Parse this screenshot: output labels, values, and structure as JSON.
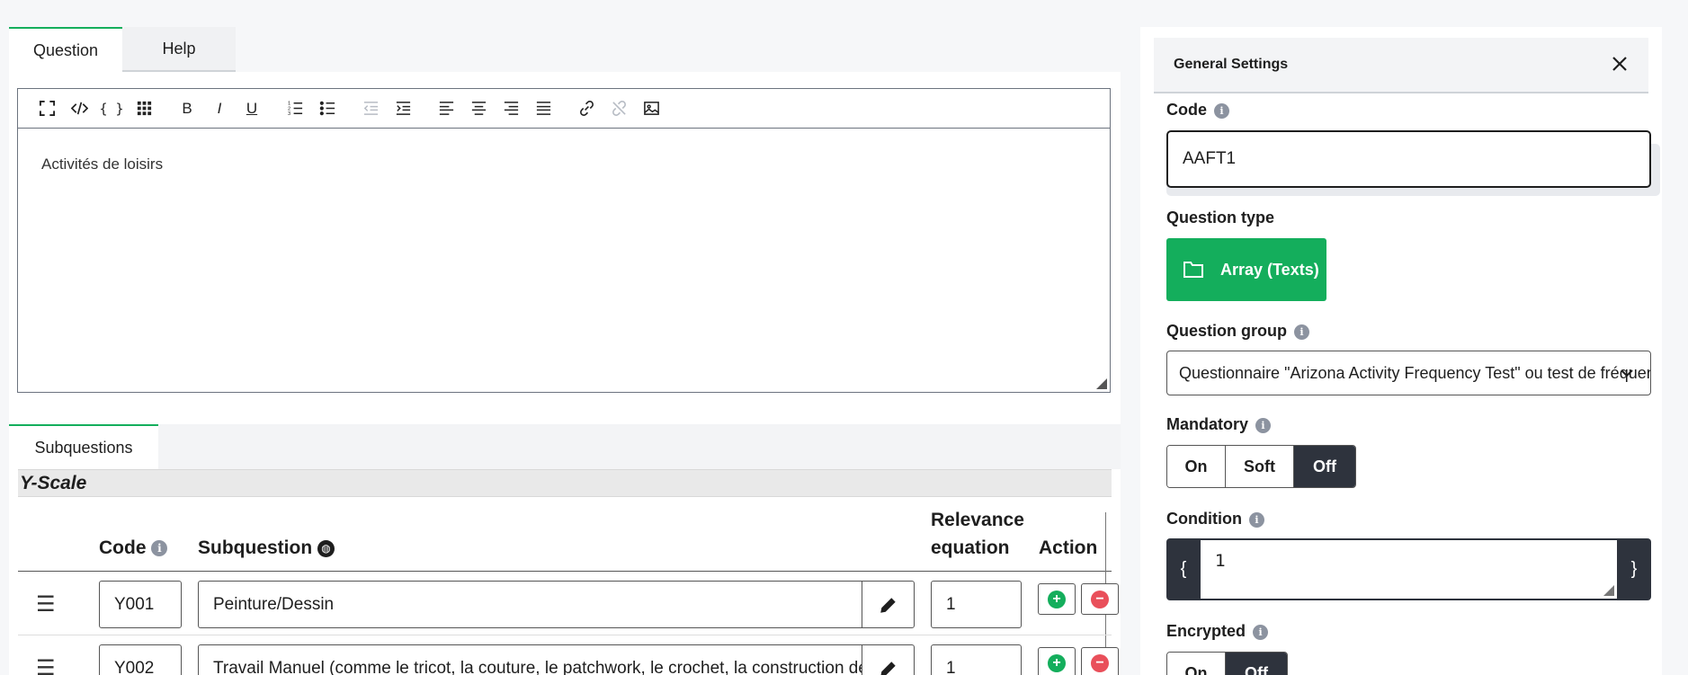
{
  "tabs": {
    "question": "Question",
    "help": "Help"
  },
  "toolbar": {
    "buttons": [
      "fullscreen-icon",
      "source-code-icon",
      "expression-icon",
      "grid-icon",
      "bold-icon",
      "italic-icon",
      "underline-icon",
      "ordered-list-icon",
      "bullet-list-icon",
      "outdent-icon",
      "indent-icon",
      "align-left-icon",
      "align-center-icon",
      "align-right-icon",
      "justify-icon",
      "link-icon",
      "unlink-icon",
      "image-icon"
    ],
    "bold": "B",
    "italic": "I",
    "underline": "U"
  },
  "editor": {
    "content": "Activités de loisirs"
  },
  "subquestions": {
    "tab_label": "Subquestions",
    "scale_title": "Y-Scale",
    "columns": {
      "code": "Code",
      "subquestion": "Subquestion",
      "relevance_line1": "Relevance",
      "relevance_line2": "equation",
      "action": "Action"
    },
    "rows": [
      {
        "code": "Y001",
        "text": "Peinture/Dessin",
        "relevance": "1"
      },
      {
        "code": "Y002",
        "text": "Travail Manuel (comme le tricot, la couture, le patchwork, le crochet, la construction de modèles réduits)",
        "relevance": "1"
      }
    ]
  },
  "settings": {
    "title": "General Settings",
    "code_label": "Code",
    "code_value": "AAFT1",
    "question_type_label": "Question type",
    "question_type_value": "Array (Texts)",
    "question_group_label": "Question group",
    "question_group_value": "Questionnaire \"Arizona Activity Frequency Test\" ou test de fréquence d'activités de l'Arizona",
    "mandatory_label": "Mandatory",
    "mandatory_options": [
      "On",
      "Soft",
      "Off"
    ],
    "mandatory_selected": "Off",
    "condition_label": "Condition",
    "condition_value": "1",
    "condition_open": "{",
    "condition_close": "}",
    "encrypted_label": "Encrypted",
    "encrypted_options": [
      "On",
      "Off"
    ],
    "encrypted_selected": "Off"
  },
  "colors": {
    "accent": "#14ae5c",
    "dark": "#2e333d",
    "danger": "#e94f5a"
  }
}
